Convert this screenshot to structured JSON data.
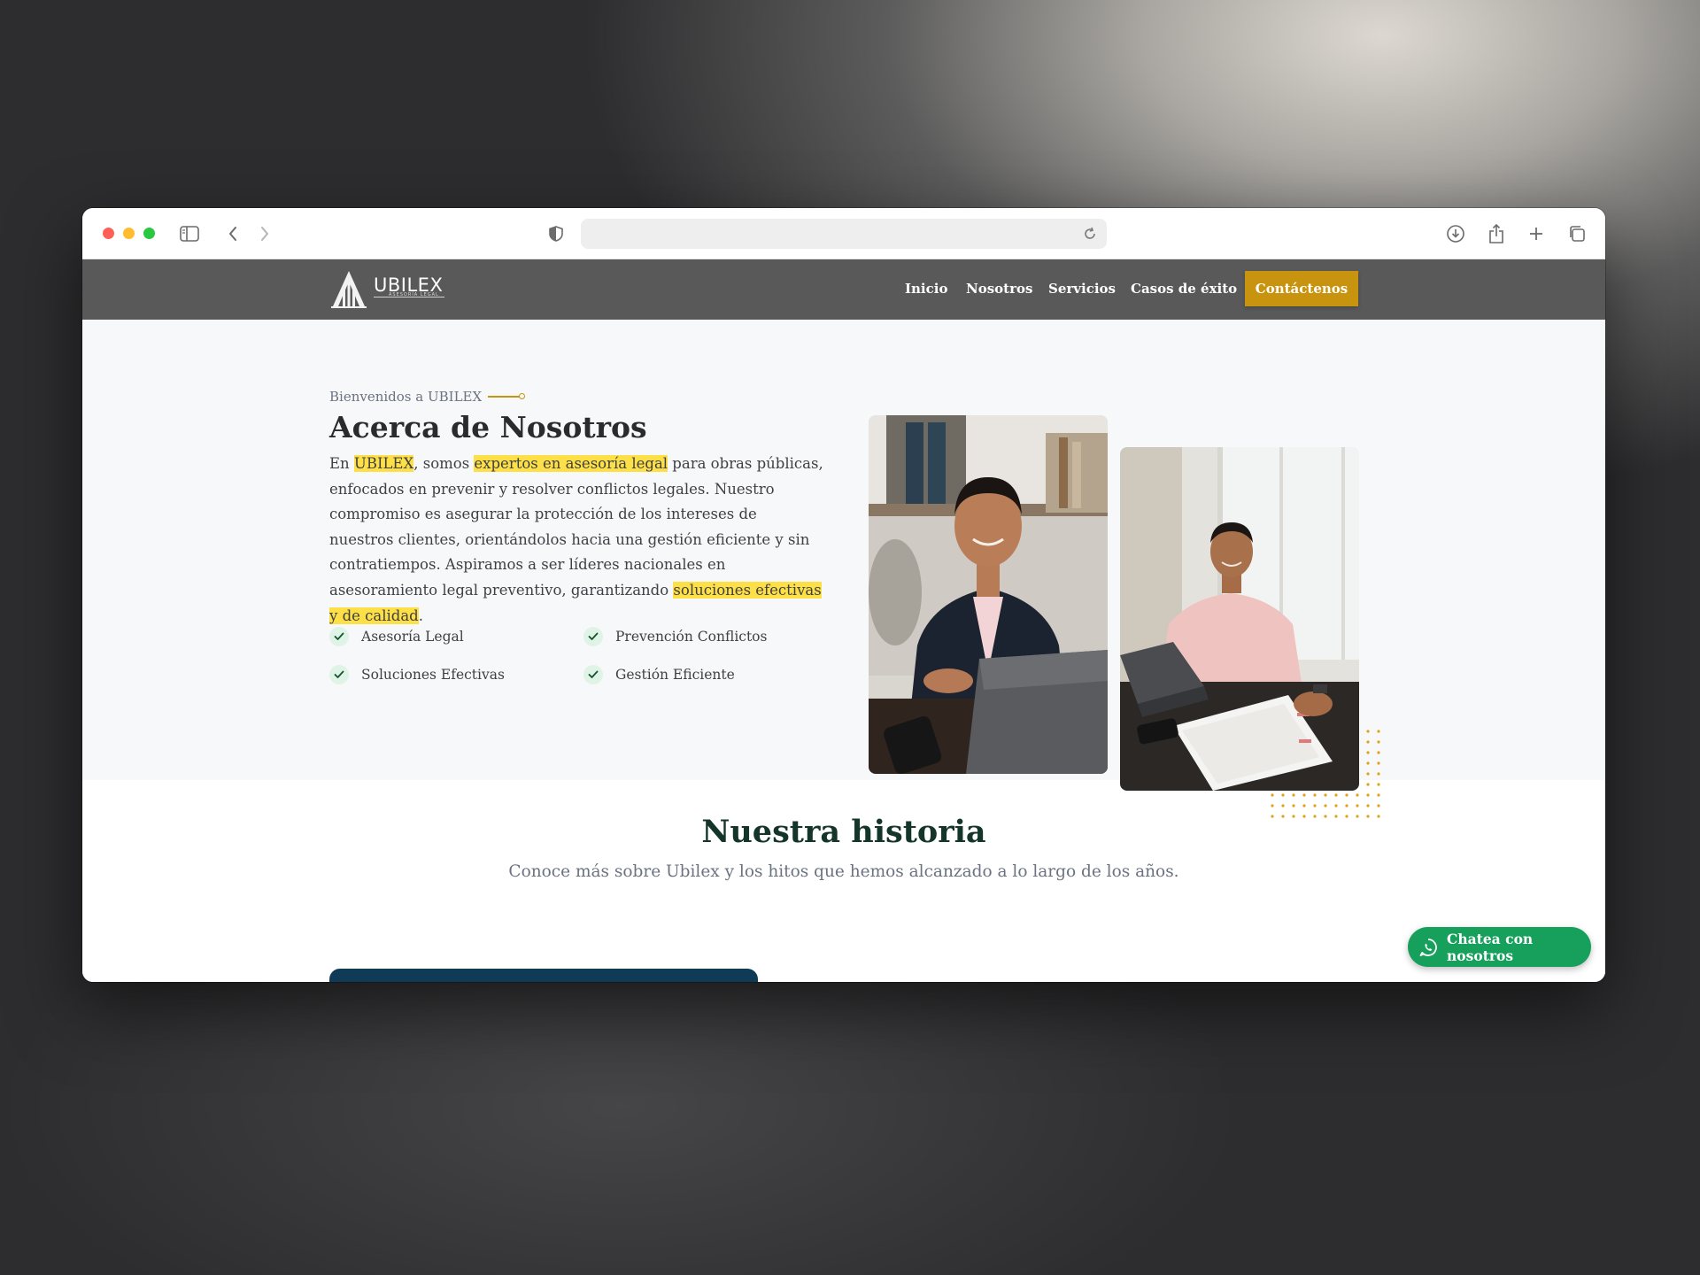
{
  "browser": {
    "url": "",
    "icons": [
      "sidebar-icon",
      "back-icon",
      "forward-icon",
      "shield-icon",
      "reload-icon",
      "download-icon",
      "share-icon",
      "new-tab-icon",
      "tabs-overview-icon"
    ]
  },
  "nav": {
    "logo_text": "UBILEX",
    "logo_tagline": "ASESORÍA LEGAL",
    "links": [
      "Inicio",
      "Nosotros",
      "Servicios",
      "Casos de éxito"
    ],
    "cta_label": "Contáctenos"
  },
  "about": {
    "eyebrow": "Bienvenidos a UBILEX",
    "title": "Acerca de Nosotros",
    "body": {
      "p1": "En ",
      "h1": "UBILEX",
      "p2": ", somos ",
      "h2": "expertos en asesoría legal",
      "p3": " para obras públicas, enfocados en prevenir y resolver conflictos legales. Nuestro compromiso es asegurar la protección de los intereses de nuestros clientes, orientándolos hacia una gestión eficiente y sin contratiempos. Aspiramos a ser líderes nacionales en asesoramiento legal preventivo, garantizando ",
      "h3": "soluciones efectivas y de calidad",
      "p4": "."
    },
    "features": [
      "Asesoría Legal",
      "Prevención Conflictos",
      "Soluciones Efectivas",
      "Gestión Eficiente"
    ]
  },
  "history": {
    "title": "Nuestra historia",
    "subtitle": "Conoce más sobre Ubilex y los hitos que hemos alcanzado a lo largo de los años."
  },
  "chat": {
    "label": "Chatea con nosotros"
  },
  "colors": {
    "nav_bg": "#595959",
    "accent_gold": "#c8940f",
    "highlight": "#fde047",
    "heading_green": "#14352a",
    "whatsapp_green": "#16a05c",
    "timeline_blue": "#0f3b57"
  }
}
